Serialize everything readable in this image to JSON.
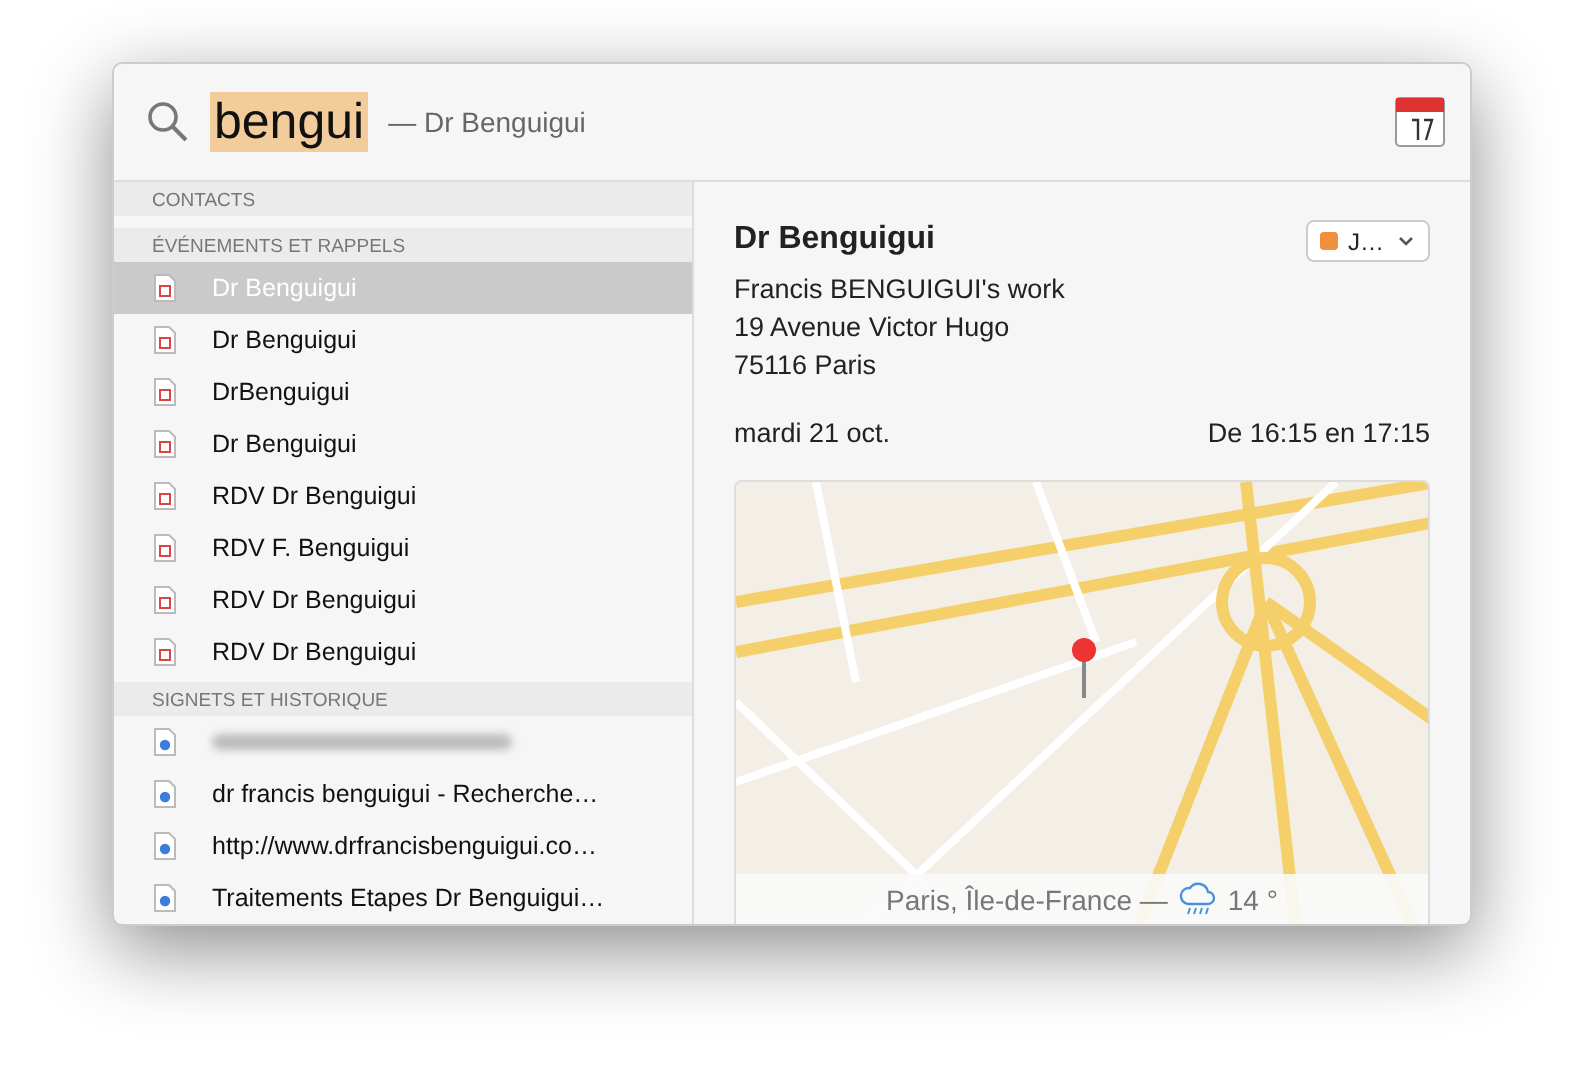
{
  "search": {
    "query": "bengui",
    "completion": "— Dr Benguigui"
  },
  "sections": [
    {
      "title": "CONTACTS"
    },
    {
      "title": "ÉVÉNEMENTS ET RAPPELS",
      "kind": "event",
      "items": [
        {
          "label": "Dr Benguigui",
          "selected": true
        },
        {
          "label": "Dr Benguigui",
          "selected": false
        },
        {
          "label": "DrBenguigui",
          "selected": false
        },
        {
          "label": "Dr Benguigui",
          "selected": false
        },
        {
          "label": "RDV Dr Benguigui",
          "selected": false
        },
        {
          "label": "RDV F. Benguigui",
          "selected": false
        },
        {
          "label": "RDV Dr Benguigui",
          "selected": false
        },
        {
          "label": "RDV Dr Benguigui",
          "selected": false
        }
      ]
    },
    {
      "title": "SIGNETS ET HISTORIQUE",
      "kind": "web",
      "items": [
        {
          "blurred": true,
          "selected": false
        },
        {
          "label": "dr francis benguigui - Recherche…",
          "selected": false
        },
        {
          "label": "http://www.drfrancisbenguigui.co…",
          "selected": false
        },
        {
          "label": "Traitements Etapes Dr Benguigui…",
          "selected": false
        }
      ]
    }
  ],
  "detail": {
    "title": "Dr Benguigui",
    "calendar": {
      "label": "J…",
      "color": "#f0903a"
    },
    "lines": [
      "Francis BENGUIGUI's work",
      "19 Avenue Victor Hugo",
      "75116 Paris"
    ],
    "date": "mardi 21 oct.",
    "time": "De 16:15 en 17:15",
    "map": {
      "place": "Paris, Île-de-France —",
      "temperature": "14 °"
    }
  }
}
